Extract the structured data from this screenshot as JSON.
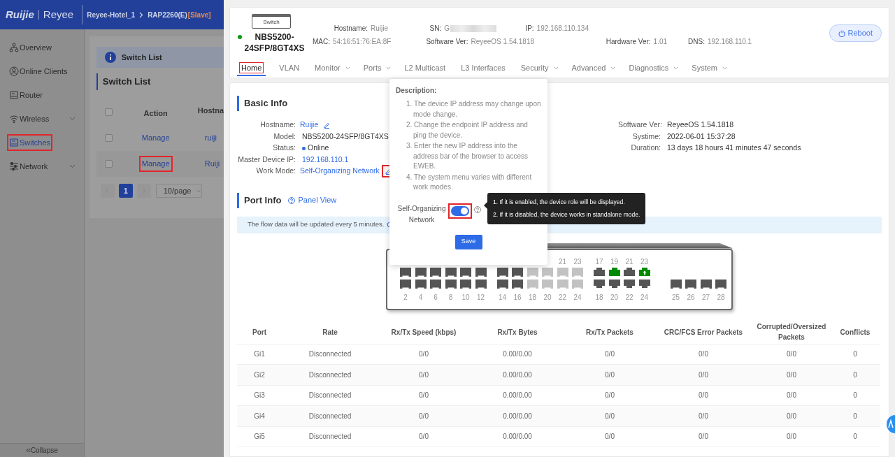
{
  "app": {
    "logo": "Ruijie",
    "logo_secondary": "Reyee",
    "breadcrumb": [
      "Reyee-Hotel_1",
      "RAP2260(E)"
    ],
    "role_tag": "[Slave]"
  },
  "sidebar": {
    "items": [
      {
        "label": "Overview",
        "expandable": false,
        "selected": false,
        "highlighted": false
      },
      {
        "label": "Online Clients",
        "expandable": false,
        "selected": false,
        "highlighted": false
      },
      {
        "label": "Router",
        "expandable": false,
        "selected": false,
        "highlighted": false
      },
      {
        "label": "Wireless",
        "expandable": true,
        "selected": false,
        "highlighted": false
      },
      {
        "label": "Switches",
        "expandable": false,
        "selected": true,
        "highlighted": true
      },
      {
        "label": "Network",
        "expandable": true,
        "selected": false,
        "highlighted": false
      }
    ],
    "collapse": "Collapse"
  },
  "switch_list": {
    "banner": "Switch List",
    "title": "Switch List",
    "select_all_checked": false,
    "columns": [
      "Action",
      "Hostna"
    ],
    "rows": [
      {
        "checked": false,
        "action": "Manage",
        "hostname": "ruiji",
        "highlighted": false
      },
      {
        "checked": false,
        "action": "Manage",
        "hostname": "Ruiji",
        "highlighted": true
      }
    ],
    "pages": [
      {
        "label": "1",
        "selected": true
      }
    ],
    "page_size": "10/page"
  },
  "device": {
    "icon_label": "Switch",
    "online": true,
    "model": "NBS5200-24SFP/8GT4XS",
    "info_rows": [
      [
        {
          "label": "Hostname:",
          "value": "Ruijie",
          "redacted": false
        },
        {
          "label": "SN:",
          "value": "G",
          "redacted": true
        },
        {
          "label": "IP:",
          "value": "192.168.110.134",
          "redacted": false
        }
      ],
      [
        {
          "label": "MAC:",
          "value": "54:16:51:76:EA:8F",
          "redacted": false
        },
        {
          "label": "Software Ver:",
          "value": "ReyeeOS 1.54.1818",
          "redacted": false
        },
        {
          "label": "Hardware Ver:",
          "value": "1.01",
          "redacted": false
        },
        {
          "label": "DNS:",
          "value": "192.168.110.1",
          "redacted": false
        }
      ]
    ],
    "reboot": "Reboot"
  },
  "tabs": [
    {
      "label": "Home",
      "selected": true,
      "dropdown": false,
      "highlighted": true
    },
    {
      "label": "VLAN",
      "selected": false,
      "dropdown": false,
      "highlighted": false
    },
    {
      "label": "Monitor",
      "selected": false,
      "dropdown": true,
      "highlighted": false
    },
    {
      "label": "Ports",
      "selected": false,
      "dropdown": true,
      "highlighted": false
    },
    {
      "label": "L2 Multicast",
      "selected": false,
      "dropdown": false,
      "highlighted": false
    },
    {
      "label": "L3 Interfaces",
      "selected": false,
      "dropdown": false,
      "highlighted": false
    },
    {
      "label": "Security",
      "selected": false,
      "dropdown": true,
      "highlighted": false
    },
    {
      "label": "Advanced",
      "selected": false,
      "dropdown": true,
      "highlighted": false
    },
    {
      "label": "Diagnostics",
      "selected": false,
      "dropdown": true,
      "highlighted": false
    },
    {
      "label": "System",
      "selected": false,
      "dropdown": true,
      "highlighted": false
    }
  ],
  "basic_info": {
    "title": "Basic Info",
    "left": [
      {
        "label": "Hostname:",
        "value": "Ruijie",
        "kind": "editable",
        "highlighted": false
      },
      {
        "label": "Model:",
        "value": "NBS5200-24SFP/8GT4XS",
        "kind": "text",
        "highlighted": false
      },
      {
        "label": "Status:",
        "value": "Online",
        "kind": "status",
        "highlighted": false
      },
      {
        "label": "Master Device IP:",
        "value": "192.168.110.1",
        "kind": "link",
        "highlighted": false
      },
      {
        "label": "Work Mode:",
        "value": "Self-Organizing Network",
        "kind": "editable",
        "highlighted": true
      }
    ],
    "right": [
      {
        "label": "Software Ver:",
        "value": "ReyeeOS 1.54.1818"
      },
      {
        "label": "Systime:",
        "value": "2022-06-01 15:37:28"
      },
      {
        "label": "Duration:",
        "value": "13 days 18 hours 41 minutes 47 seconds"
      }
    ]
  },
  "port_info": {
    "title": "Port Info",
    "panel_view": "Panel View",
    "notice": "The flow data will be updated every 5 minutes.",
    "panel": {
      "groups": [
        {
          "kind": "sfp",
          "top": [
            {
              "kind": "idle"
            },
            {
              "kind": "idle"
            },
            {
              "kind": "idle"
            },
            {
              "kind": "idle"
            },
            {
              "kind": "idle"
            },
            {
              "kind": "idle"
            }
          ],
          "bottom": [
            {
              "label": "2",
              "kind": "idle"
            },
            {
              "label": "4",
              "kind": "idle"
            },
            {
              "label": "6",
              "kind": "idle"
            },
            {
              "label": "8",
              "kind": "idle"
            },
            {
              "label": "10",
              "kind": "idle"
            },
            {
              "label": "12",
              "kind": "idle"
            }
          ]
        },
        {
          "kind": "sfp",
          "top": [
            {
              "kind": "idle"
            },
            {
              "kind": "idle"
            },
            {
              "kind": "inactive"
            },
            {
              "kind": "inactive"
            },
            {
              "label": "21",
              "kind": "inactive"
            },
            {
              "label": "23",
              "kind": "inactive"
            }
          ],
          "bottom": [
            {
              "label": "14",
              "kind": "idle"
            },
            {
              "label": "16",
              "kind": "idle"
            },
            {
              "label": "18",
              "kind": "inactive"
            },
            {
              "label": "20",
              "kind": "inactive"
            },
            {
              "label": "22",
              "kind": "inactive"
            },
            {
              "label": "24",
              "kind": "inactive"
            }
          ]
        },
        {
          "kind": "rj45",
          "top": [
            {
              "label": "17",
              "kind": "idle"
            },
            {
              "label": "19",
              "kind": "up"
            },
            {
              "label": "21",
              "kind": "idle"
            },
            {
              "label": "23",
              "kind": "uplink"
            }
          ],
          "bottom": [
            {
              "label": "18",
              "kind": "idle"
            },
            {
              "label": "20",
              "kind": "idle"
            },
            {
              "label": "22",
              "kind": "idle"
            },
            {
              "label": "24",
              "kind": "idle"
            }
          ]
        },
        {
          "kind": "sfp",
          "bottom": [
            {
              "label": "25",
              "kind": "idle"
            },
            {
              "label": "26",
              "kind": "idle"
            },
            {
              "label": "27",
              "kind": "idle"
            },
            {
              "label": "28",
              "kind": "idle"
            }
          ]
        }
      ]
    },
    "table": {
      "columns": [
        "Port",
        "Rate",
        "Rx/Tx Speed (kbps)",
        "Rx/Tx Bytes",
        "Rx/Tx Packets",
        "CRC/FCS Error Packets",
        "Corrupted/Oversized Packets",
        "Conflicts"
      ],
      "rows": [
        [
          "Gi1",
          "Disconnected",
          "0/0",
          "0.00/0.00",
          "0/0",
          "0/0",
          "0/0",
          "0"
        ],
        [
          "Gi2",
          "Disconnected",
          "0/0",
          "0.00/0.00",
          "0/0",
          "0/0",
          "0/0",
          "0"
        ],
        [
          "Gi3",
          "Disconnected",
          "0/0",
          "0.00/0.00",
          "0/0",
          "0/0",
          "0/0",
          "0"
        ],
        [
          "Gi4",
          "Disconnected",
          "0/0",
          "0.00/0.00",
          "0/0",
          "0/0",
          "0/0",
          "0"
        ],
        [
          "Gi5",
          "Disconnected",
          "0/0",
          "0.00/0.00",
          "0/0",
          "0/0",
          "0/0",
          "0"
        ]
      ]
    }
  },
  "popover": {
    "heading": "Description:",
    "steps": [
      "1. The device IP address may change upon mode change.",
      "2. Change the endpoint IP address and ping the device.",
      "3. Enter the new IP address into the address bar of the browser to access EWEB.",
      "4. The system menu varies with different work modes."
    ],
    "toggle_label": "Self-Organizing Network",
    "toggle_on": true,
    "toggle_highlighted": true,
    "save": "Save"
  },
  "tooltip": {
    "lines": [
      "1. If it is enabled, the device role will be displayed.",
      "2. If it is disabled, the device works in standalone mode."
    ]
  }
}
